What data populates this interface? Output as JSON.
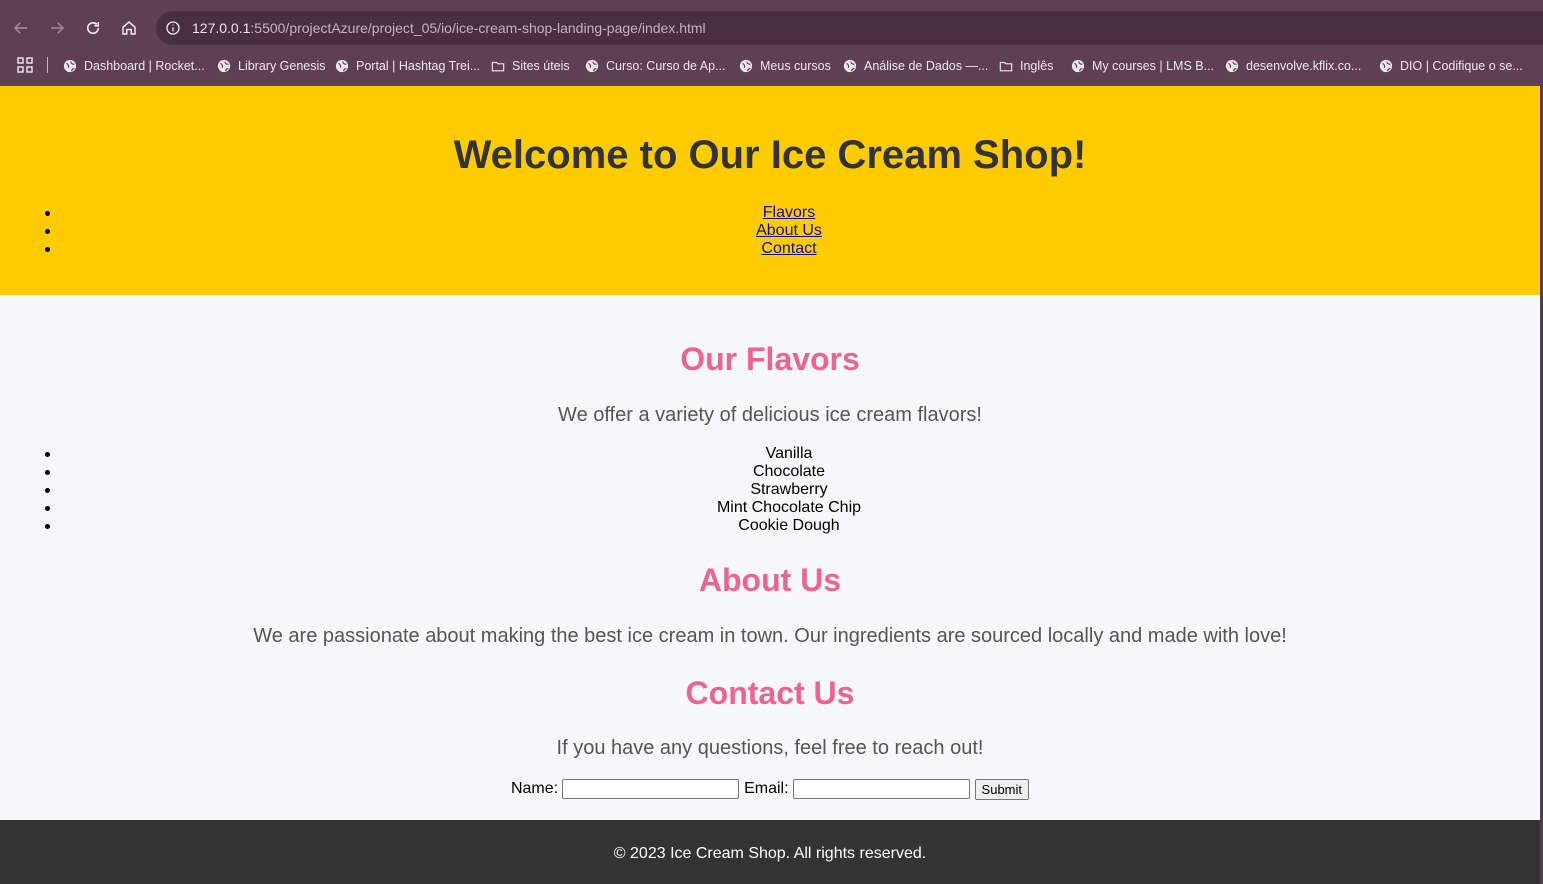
{
  "browser": {
    "url_host": "127.0.0.1",
    "url_path": ":5500/projectAzure/project_05/io/ice-cream-shop-landing-page/index.html",
    "bookmarks": [
      {
        "label": "Dashboard | Rocket...",
        "icon": "globe-icon"
      },
      {
        "label": "Library Genesis",
        "icon": "globe-icon"
      },
      {
        "label": "Portal | Hashtag Trei...",
        "icon": "globe-icon"
      },
      {
        "label": "Sites úteis",
        "icon": "folder-icon"
      },
      {
        "label": "Curso: Curso de Ap...",
        "icon": "globe-icon"
      },
      {
        "label": "Meus cursos",
        "icon": "globe-icon"
      },
      {
        "label": "Análise de Dados —...",
        "icon": "globe-icon"
      },
      {
        "label": "Inglês",
        "icon": "folder-icon"
      },
      {
        "label": "My courses | LMS B...",
        "icon": "globe-icon"
      },
      {
        "label": "desenvolve.kflix.co...",
        "icon": "globe-icon"
      },
      {
        "label": "DIO | Codifique o se...",
        "icon": "globe-icon"
      }
    ]
  },
  "header": {
    "title": "Welcome to Our Ice Cream Shop!",
    "nav": [
      "Flavors",
      "About Us",
      "Contact"
    ]
  },
  "flavors": {
    "title": "Our Flavors",
    "intro": "We offer a variety of delicious ice cream flavors!",
    "items": [
      "Vanilla",
      "Chocolate",
      "Strawberry",
      "Mint Chocolate Chip",
      "Cookie Dough"
    ]
  },
  "about": {
    "title": "About Us",
    "text": "We are passionate about making the best ice cream in town. Our ingredients are sourced locally and made with love!"
  },
  "contact": {
    "title": "Contact Us",
    "text": "If you have any questions, feel free to reach out!",
    "name_label": "Name:",
    "email_label": "Email:",
    "submit_label": "Submit"
  },
  "footer": {
    "text": "© 2023 Ice Cream Shop. All rights reserved."
  },
  "colors": {
    "header_bg": "#ffcc00",
    "section_title": "#f06292",
    "footer_bg": "#333333",
    "page_bg": "#f7f8fa"
  }
}
